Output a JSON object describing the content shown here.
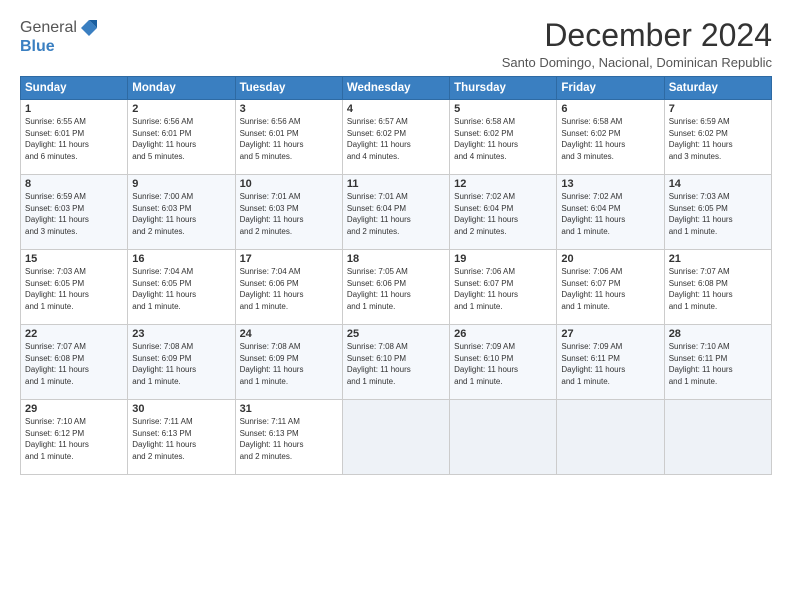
{
  "header": {
    "logo_line1": "General",
    "logo_line2": "Blue",
    "month": "December 2024",
    "location": "Santo Domingo, Nacional, Dominican Republic"
  },
  "columns": [
    "Sunday",
    "Monday",
    "Tuesday",
    "Wednesday",
    "Thursday",
    "Friday",
    "Saturday"
  ],
  "weeks": [
    [
      {
        "day": "1",
        "info": "Sunrise: 6:55 AM\nSunset: 6:01 PM\nDaylight: 11 hours\nand 6 minutes."
      },
      {
        "day": "2",
        "info": "Sunrise: 6:56 AM\nSunset: 6:01 PM\nDaylight: 11 hours\nand 5 minutes."
      },
      {
        "day": "3",
        "info": "Sunrise: 6:56 AM\nSunset: 6:01 PM\nDaylight: 11 hours\nand 5 minutes."
      },
      {
        "day": "4",
        "info": "Sunrise: 6:57 AM\nSunset: 6:02 PM\nDaylight: 11 hours\nand 4 minutes."
      },
      {
        "day": "5",
        "info": "Sunrise: 6:58 AM\nSunset: 6:02 PM\nDaylight: 11 hours\nand 4 minutes."
      },
      {
        "day": "6",
        "info": "Sunrise: 6:58 AM\nSunset: 6:02 PM\nDaylight: 11 hours\nand 3 minutes."
      },
      {
        "day": "7",
        "info": "Sunrise: 6:59 AM\nSunset: 6:02 PM\nDaylight: 11 hours\nand 3 minutes."
      }
    ],
    [
      {
        "day": "8",
        "info": "Sunrise: 6:59 AM\nSunset: 6:03 PM\nDaylight: 11 hours\nand 3 minutes."
      },
      {
        "day": "9",
        "info": "Sunrise: 7:00 AM\nSunset: 6:03 PM\nDaylight: 11 hours\nand 2 minutes."
      },
      {
        "day": "10",
        "info": "Sunrise: 7:01 AM\nSunset: 6:03 PM\nDaylight: 11 hours\nand 2 minutes."
      },
      {
        "day": "11",
        "info": "Sunrise: 7:01 AM\nSunset: 6:04 PM\nDaylight: 11 hours\nand 2 minutes."
      },
      {
        "day": "12",
        "info": "Sunrise: 7:02 AM\nSunset: 6:04 PM\nDaylight: 11 hours\nand 2 minutes."
      },
      {
        "day": "13",
        "info": "Sunrise: 7:02 AM\nSunset: 6:04 PM\nDaylight: 11 hours\nand 1 minute."
      },
      {
        "day": "14",
        "info": "Sunrise: 7:03 AM\nSunset: 6:05 PM\nDaylight: 11 hours\nand 1 minute."
      }
    ],
    [
      {
        "day": "15",
        "info": "Sunrise: 7:03 AM\nSunset: 6:05 PM\nDaylight: 11 hours\nand 1 minute."
      },
      {
        "day": "16",
        "info": "Sunrise: 7:04 AM\nSunset: 6:05 PM\nDaylight: 11 hours\nand 1 minute."
      },
      {
        "day": "17",
        "info": "Sunrise: 7:04 AM\nSunset: 6:06 PM\nDaylight: 11 hours\nand 1 minute."
      },
      {
        "day": "18",
        "info": "Sunrise: 7:05 AM\nSunset: 6:06 PM\nDaylight: 11 hours\nand 1 minute."
      },
      {
        "day": "19",
        "info": "Sunrise: 7:06 AM\nSunset: 6:07 PM\nDaylight: 11 hours\nand 1 minute."
      },
      {
        "day": "20",
        "info": "Sunrise: 7:06 AM\nSunset: 6:07 PM\nDaylight: 11 hours\nand 1 minute."
      },
      {
        "day": "21",
        "info": "Sunrise: 7:07 AM\nSunset: 6:08 PM\nDaylight: 11 hours\nand 1 minute."
      }
    ],
    [
      {
        "day": "22",
        "info": "Sunrise: 7:07 AM\nSunset: 6:08 PM\nDaylight: 11 hours\nand 1 minute."
      },
      {
        "day": "23",
        "info": "Sunrise: 7:08 AM\nSunset: 6:09 PM\nDaylight: 11 hours\nand 1 minute."
      },
      {
        "day": "24",
        "info": "Sunrise: 7:08 AM\nSunset: 6:09 PM\nDaylight: 11 hours\nand 1 minute."
      },
      {
        "day": "25",
        "info": "Sunrise: 7:08 AM\nSunset: 6:10 PM\nDaylight: 11 hours\nand 1 minute."
      },
      {
        "day": "26",
        "info": "Sunrise: 7:09 AM\nSunset: 6:10 PM\nDaylight: 11 hours\nand 1 minute."
      },
      {
        "day": "27",
        "info": "Sunrise: 7:09 AM\nSunset: 6:11 PM\nDaylight: 11 hours\nand 1 minute."
      },
      {
        "day": "28",
        "info": "Sunrise: 7:10 AM\nSunset: 6:11 PM\nDaylight: 11 hours\nand 1 minute."
      }
    ],
    [
      {
        "day": "29",
        "info": "Sunrise: 7:10 AM\nSunset: 6:12 PM\nDaylight: 11 hours\nand 1 minute."
      },
      {
        "day": "30",
        "info": "Sunrise: 7:11 AM\nSunset: 6:13 PM\nDaylight: 11 hours\nand 2 minutes."
      },
      {
        "day": "31",
        "info": "Sunrise: 7:11 AM\nSunset: 6:13 PM\nDaylight: 11 hours\nand 2 minutes."
      },
      null,
      null,
      null,
      null
    ]
  ]
}
